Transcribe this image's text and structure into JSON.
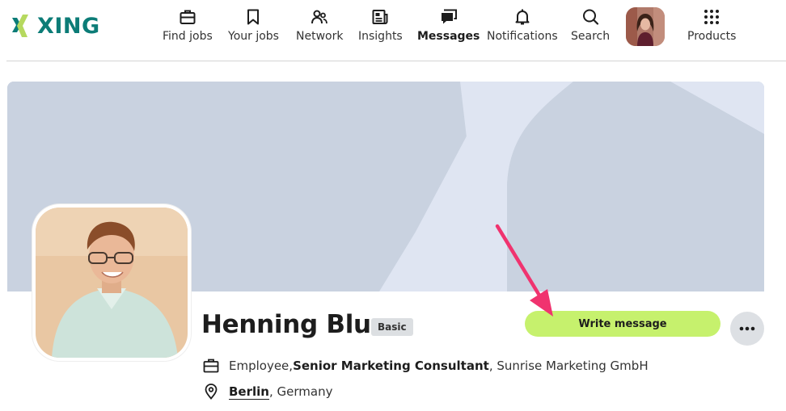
{
  "brand": {
    "name": "XING",
    "color": "#0c7c77"
  },
  "nav": {
    "items": [
      {
        "id": "find-jobs",
        "label": "Find jobs",
        "icon": "briefcase-icon"
      },
      {
        "id": "your-jobs",
        "label": "Your jobs",
        "icon": "bookmark-icon"
      },
      {
        "id": "network",
        "label": "Network",
        "icon": "people-icon"
      },
      {
        "id": "insights",
        "label": "Insights",
        "icon": "news-icon"
      },
      {
        "id": "messages",
        "label": "Messages",
        "icon": "chat-icon",
        "active": true
      },
      {
        "id": "notifications",
        "label": "Notifications",
        "icon": "bell-icon"
      },
      {
        "id": "search",
        "label": "Search",
        "icon": "search-icon"
      }
    ],
    "products_label": "Products"
  },
  "profile": {
    "name": "Henning Blum",
    "membership_badge": "Basic",
    "job": {
      "role": "Employee, ",
      "title": "Senior Marketing Consultant",
      "company": ", Sunrise Marketing GmbH"
    },
    "location": {
      "city": "Berlin",
      "country": ", Germany"
    },
    "write_message_label": "Write message",
    "more_label": "•••"
  },
  "colors": {
    "accent_button": "#c6f16d",
    "annotation_arrow": "#f0336f",
    "cover_light": "#dfe5f2",
    "cover_dark": "#c9d2e0"
  }
}
